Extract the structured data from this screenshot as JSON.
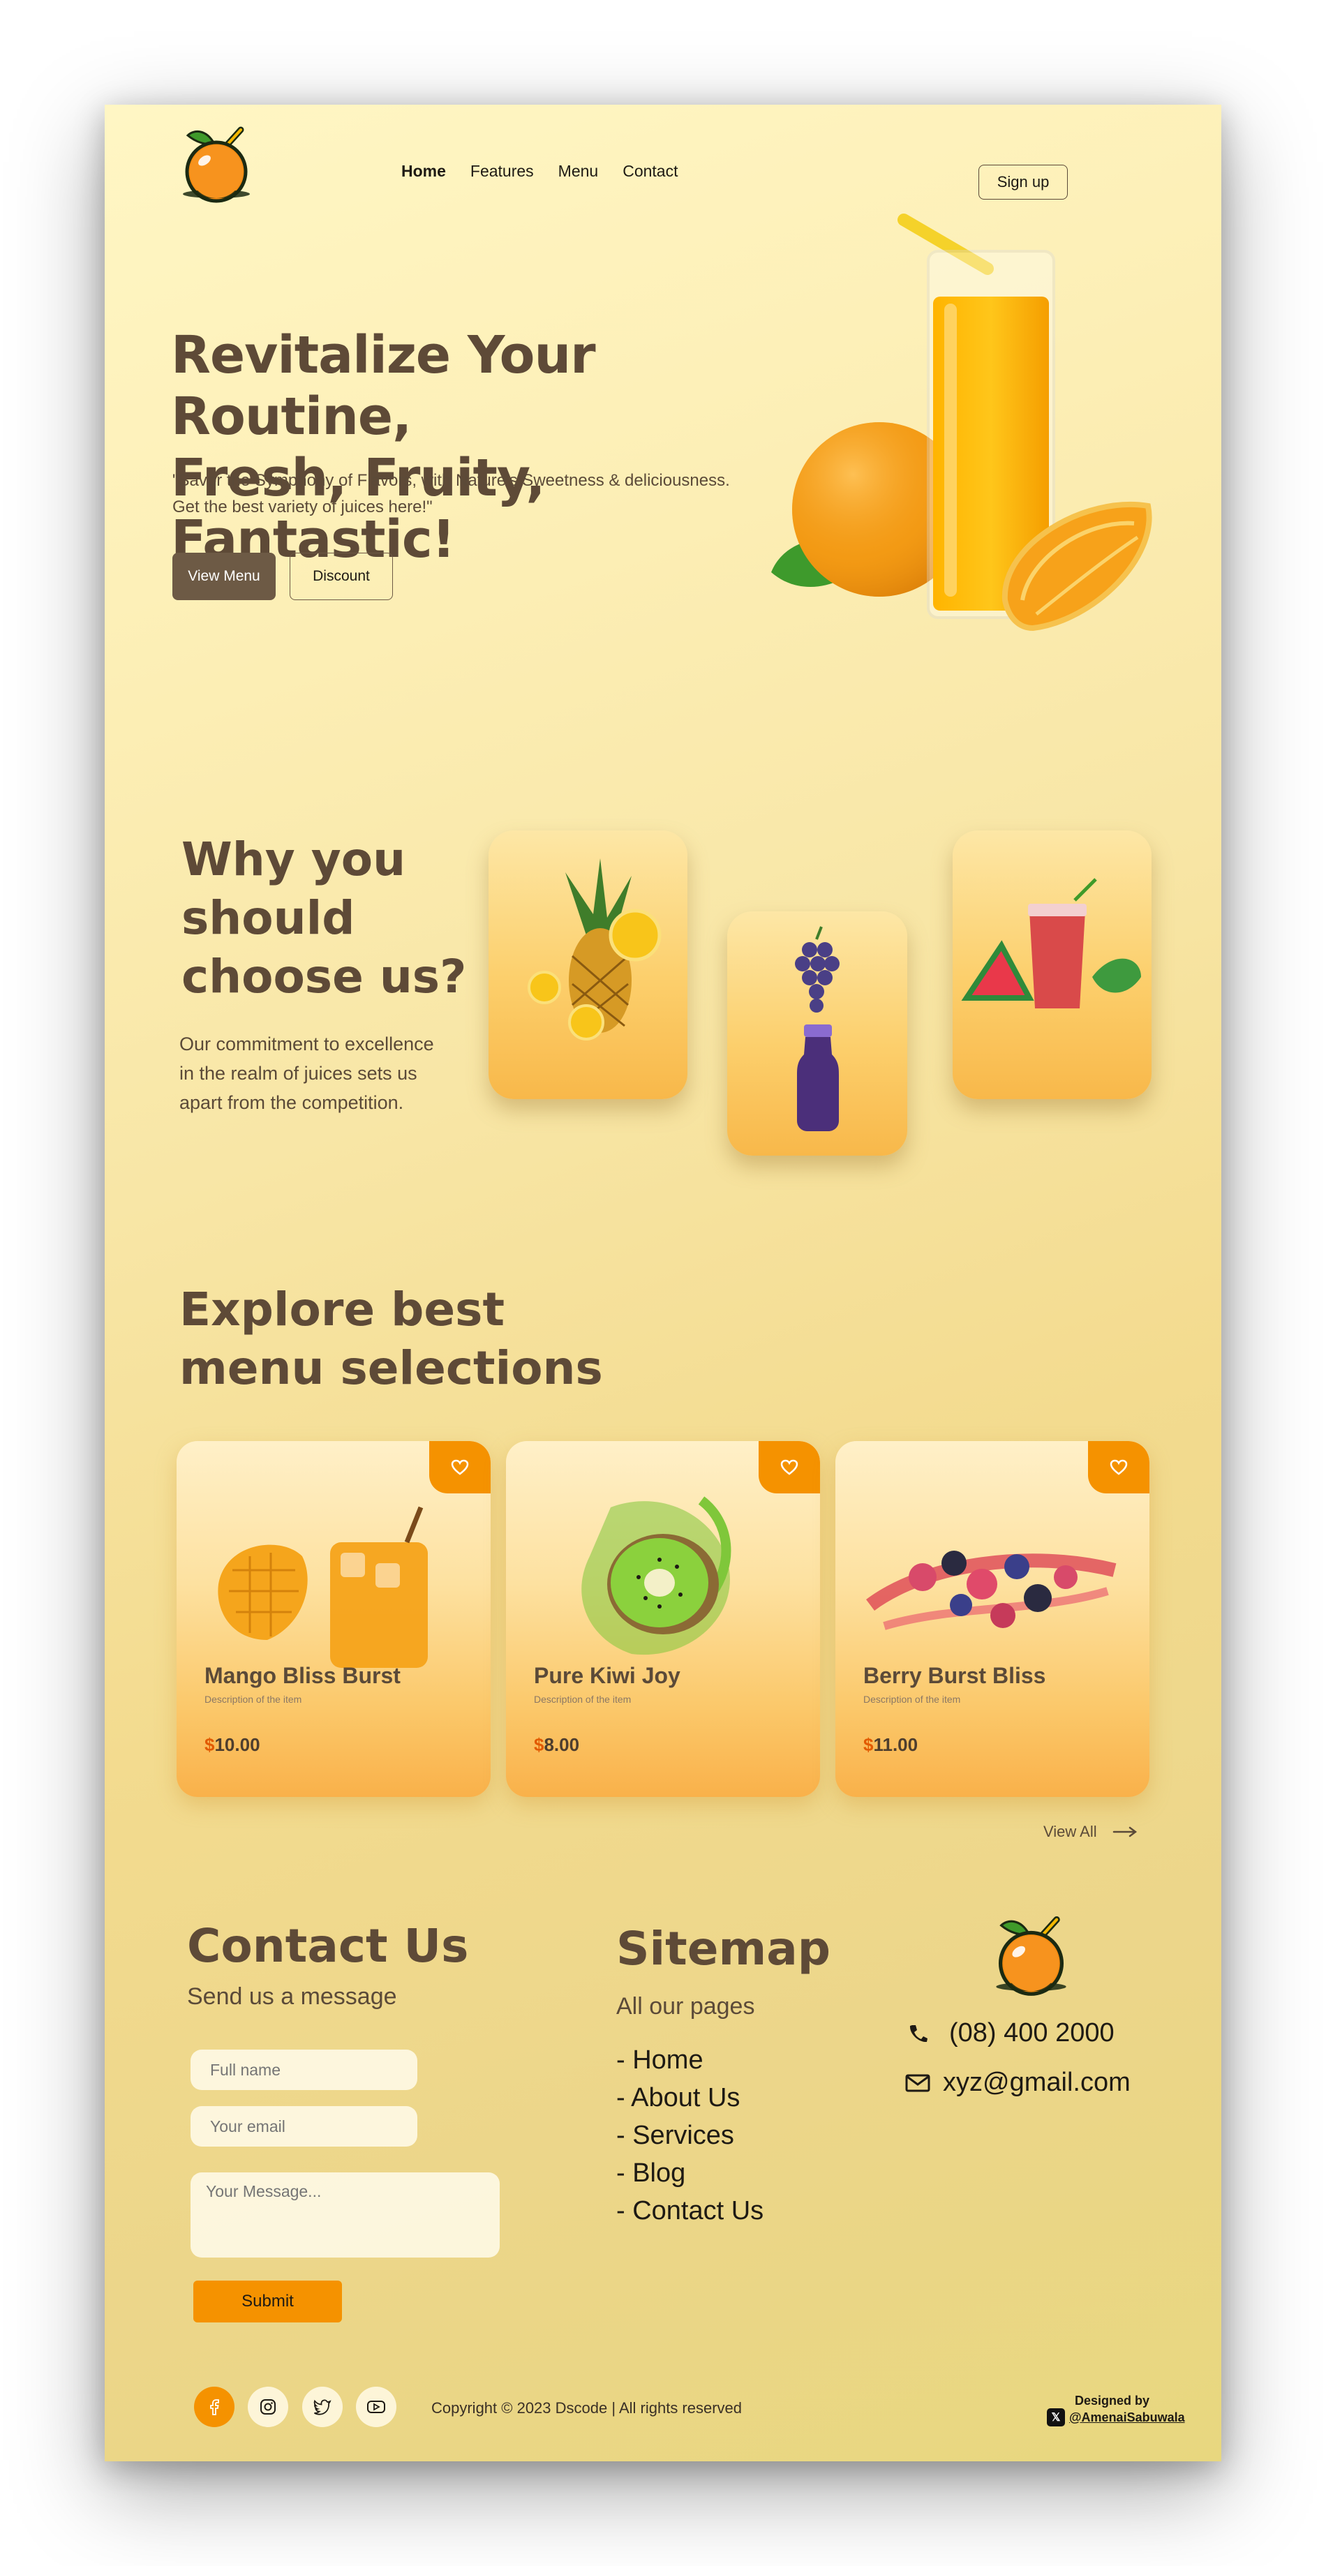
{
  "nav": {
    "items": [
      "Home",
      "Features",
      "Menu",
      "Contact"
    ],
    "signup_label": "Sign up"
  },
  "hero": {
    "title_line1": "Revitalize Your Routine,",
    "title_line2": "Fresh, Fruity, Fantastic!",
    "subtitle_line1": "\"Savor the Symphony of Flavors, with Nature's Sweetness & deliciousness.",
    "subtitle_line2": "Get the best variety of juices here!\"",
    "view_menu_label": "View Menu",
    "discount_label": "Discount"
  },
  "why": {
    "title_line1": "Why you",
    "title_line2": "should",
    "title_line3": "choose us?",
    "text_line1": "Our commitment to excellence",
    "text_line2": "in the realm of juices sets us",
    "text_line3": "apart from the competition."
  },
  "explore": {
    "title_line1": "Explore best",
    "title_line2": "menu selections",
    "items": [
      {
        "name": "Mango Bliss Burst",
        "desc": "Description of the item",
        "currency": "$",
        "price": "10.00"
      },
      {
        "name": "Pure Kiwi Joy",
        "desc": "Description of the item",
        "currency": "$",
        "price": "8.00"
      },
      {
        "name": "Berry Burst Bliss",
        "desc": "Description of the item",
        "currency": "$",
        "price": "11.00"
      }
    ],
    "view_all_label": "View All"
  },
  "contact": {
    "title": "Contact Us",
    "subtitle": "Send us a message",
    "fullname_placeholder": "Full name",
    "email_placeholder": "Your email",
    "message_placeholder": "Your Message...",
    "submit_label": "Submit"
  },
  "sitemap": {
    "title": "Sitemap",
    "subtitle": "All our pages",
    "links": [
      "- Home",
      "- About Us",
      "- Services",
      "- Blog",
      "- Contact Us"
    ]
  },
  "info": {
    "phone": "(08) 400 2000",
    "email": "xyz@gmail.com"
  },
  "footer": {
    "copyright": "Copyright  ©  2023 Dscode | All rights reserved",
    "designed_by": "Designed by",
    "designer_handle": "@AmenaiSabuwala"
  },
  "colors": {
    "accent": "#f59200",
    "brown": "#5e4a37",
    "button_dark": "#6d5a45"
  }
}
